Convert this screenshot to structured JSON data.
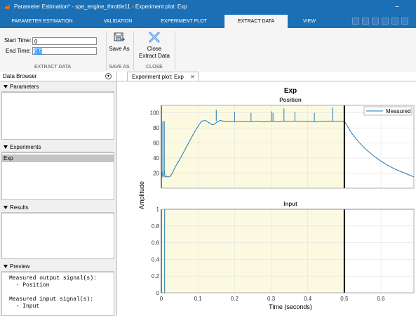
{
  "window": {
    "title": "Parameter Estimation* - spe_engine_throttle11 - Experiment plot: Exp",
    "minimize": "–",
    "close": "✕"
  },
  "tabs": [
    {
      "label": "PARAMETER ESTIMATION"
    },
    {
      "label": "VALIDATION"
    },
    {
      "label": "EXPERIMENT PLOT"
    },
    {
      "label": "EXTRACT DATA",
      "active": true
    },
    {
      "label": "VIEW"
    }
  ],
  "toolstrip": {
    "start_time_label": "Start Time:",
    "start_time_value": "0",
    "end_time_label": "End Time:",
    "end_time_value": "0.5",
    "group_extract_data": "EXTRACT DATA",
    "save_as_label": "Save As",
    "group_save_as": "SAVE AS",
    "close_line1": "Close",
    "close_line2": "Extract Data",
    "group_close": "CLOSE"
  },
  "data_browser": {
    "title": "Data Browser",
    "parameters_label": "Parameters",
    "experiments_label": "Experiments",
    "experiment_item": "Exp",
    "results_label": "Results",
    "preview_label": "Preview",
    "preview_lines": [
      "Measured output signal(s):",
      "  - Position",
      "",
      "Measured input signal(s):",
      "  - Input"
    ]
  },
  "document": {
    "tab_label": "Experiment plot: Exp",
    "tab_close": "✕"
  },
  "chart_data": {
    "title": "Exp",
    "ylabel": "Amplitude",
    "xlabel": "Time (seconds)",
    "x_ticks": [
      0,
      0.1,
      0.2,
      0.3,
      0.4,
      0.5,
      0.6
    ],
    "xlim": [
      0,
      0.69
    ],
    "grid": true,
    "extract_range": [
      0,
      0.5
    ],
    "highlight_color": "#fbf9e0",
    "line_color": "#1f77b4",
    "subplots": [
      {
        "title": "Position",
        "type": "line",
        "ylim": [
          0,
          110
        ],
        "y_ticks": [
          20,
          40,
          60,
          80,
          100
        ],
        "legend": {
          "label": "Measured",
          "placement": "top-right"
        },
        "series": [
          {
            "name": "Measured",
            "x": [
              0,
              0.002,
              0.004,
              0.006,
              0.008,
              0.01,
              0.012,
              0.014,
              0.016,
              0.018,
              0.02,
              0.025,
              0.03,
              0.035,
              0.04,
              0.05,
              0.06,
              0.07,
              0.08,
              0.09,
              0.1,
              0.11,
              0.12,
              0.13,
              0.14,
              0.145,
              0.15,
              0.16,
              0.17,
              0.18,
              0.19,
              0.2,
              0.22,
              0.24,
              0.26,
              0.28,
              0.3,
              0.32,
              0.34,
              0.36,
              0.38,
              0.4,
              0.42,
              0.44,
              0.46,
              0.48,
              0.5,
              0.52,
              0.54,
              0.56,
              0.58,
              0.6,
              0.62,
              0.64,
              0.66,
              0.69
            ],
            "y": [
              15,
              22,
              15,
              16,
              24,
              15,
              15,
              16,
              15,
              15,
              15,
              16,
              20,
              25,
              30,
              38,
              47,
              56,
              65,
              74,
              82,
              89,
              90,
              87,
              84,
              85,
              87,
              90,
              89,
              88,
              89,
              88,
              89,
              88,
              89,
              88,
              89,
              88,
              89,
              89,
              89,
              89,
              88,
              89,
              89,
              89,
              89,
              73,
              61,
              51,
              43,
              36,
              30,
              25,
              21,
              15
            ]
          }
        ],
        "spikes": [
          {
            "x": 0.004,
            "y": 22
          },
          {
            "x": 0.008,
            "y": 24
          },
          {
            "x": 0.15,
            "y": 104
          },
          {
            "x": 0.2,
            "y": 101
          },
          {
            "x": 0.245,
            "y": 100
          },
          {
            "x": 0.3,
            "y": 102
          },
          {
            "x": 0.305,
            "y": 100
          },
          {
            "x": 0.335,
            "y": 106
          },
          {
            "x": 0.365,
            "y": 101
          },
          {
            "x": 0.418,
            "y": 100
          },
          {
            "x": 0.468,
            "y": 107
          }
        ]
      },
      {
        "title": "Input",
        "type": "line",
        "ylim": [
          0,
          1
        ],
        "y_ticks": [
          0,
          0.2,
          0.4,
          0.6,
          0.8,
          1
        ],
        "series": [
          {
            "name": "Input",
            "x": [
              0,
              0.009,
              0.009,
              0.69
            ],
            "y": [
              0,
              0,
              1,
              1
            ]
          }
        ]
      }
    ]
  }
}
